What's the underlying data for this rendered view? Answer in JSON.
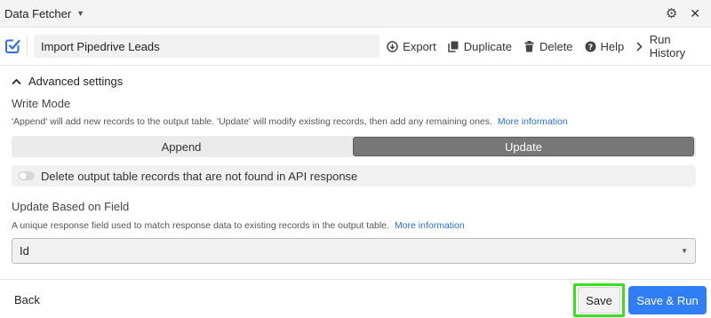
{
  "titlebar": {
    "title": "Data Fetcher",
    "settings_icon": "gear-icon",
    "close_icon": "close-icon"
  },
  "toolbar": {
    "name_value": "Import Pipedrive Leads",
    "actions": [
      {
        "label": "Export",
        "icon": "download-circle-icon"
      },
      {
        "label": "Duplicate",
        "icon": "duplicate-icon"
      },
      {
        "label": "Delete",
        "icon": "trash-icon"
      },
      {
        "label": "Help",
        "icon": "help-circle-icon"
      },
      {
        "label": "Run History",
        "icon": "chevron-right-icon"
      }
    ]
  },
  "advanced": {
    "header": "Advanced settings",
    "write_mode": {
      "label": "Write Mode",
      "help": "'Append' will add new records to the output table. 'Update' will modify existing records, then add any remaining ones.",
      "link": "More information",
      "options": [
        "Append",
        "Update"
      ],
      "selected": "Update"
    },
    "delete_toggle": {
      "label": "Delete output table records that are not found in API response",
      "checked": false
    },
    "update_field": {
      "label": "Update Based on Field",
      "help": "A unique response field used to match response data to existing records in the output table.",
      "link": "More information",
      "value": "Id"
    }
  },
  "footer": {
    "back_label": "Back",
    "save_label": "Save",
    "save_run_label": "Save & Run"
  },
  "colors": {
    "primary_button": "#2f7ef5",
    "highlight": "#39e01f",
    "link": "#2a6fdb",
    "brand_icon": "#2a6fdb"
  }
}
